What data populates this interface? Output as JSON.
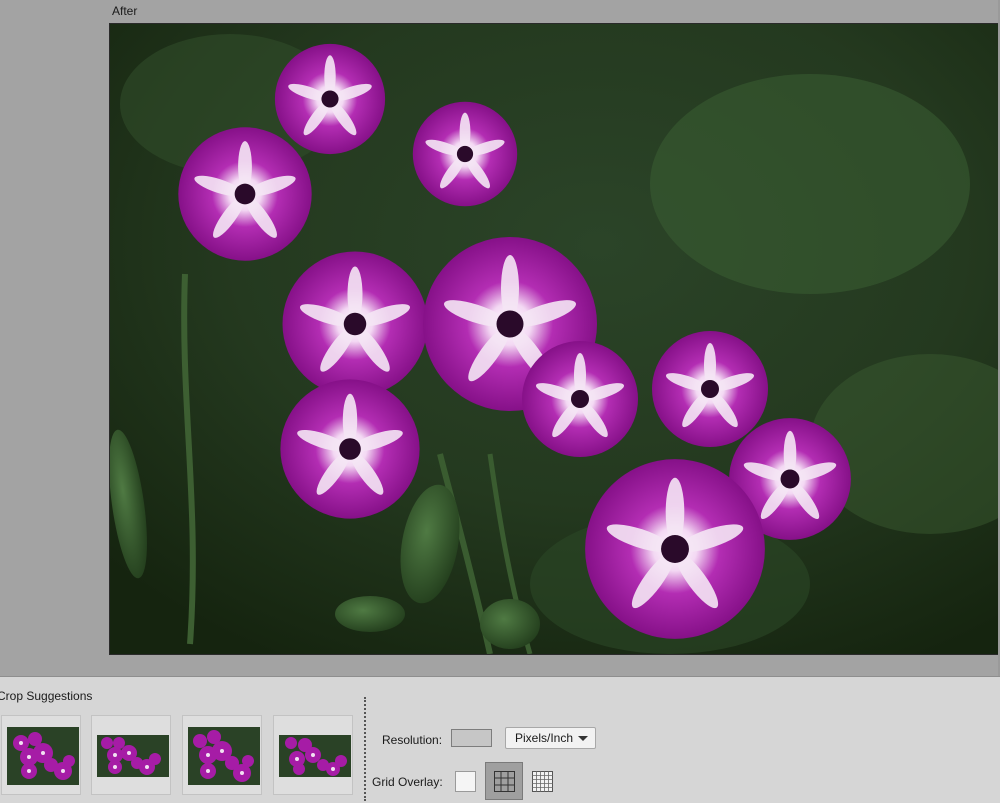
{
  "preview": {
    "label": "After"
  },
  "crop_panel": {
    "title": "Crop Suggestions",
    "suggestions": [
      "crop-suggestion-1",
      "crop-suggestion-2",
      "crop-suggestion-3",
      "crop-suggestion-4"
    ]
  },
  "options": {
    "resolution_label": "Resolution:",
    "resolution_value": "",
    "units_value": "Pixels/Inch",
    "grid_label": "Grid Overlay:",
    "grid_modes": [
      "none-icon",
      "rule-of-thirds-grid-icon",
      "fine-grid-icon"
    ],
    "grid_selected": "rule-of-thirds-grid-icon"
  },
  "colors": {
    "panel_bg": "#d6d6d6",
    "workspace_bg": "#a3a3a3",
    "flower_magenta": "#a0179f",
    "flower_center": "#ffffff",
    "foliage": "#2f5a2a"
  }
}
